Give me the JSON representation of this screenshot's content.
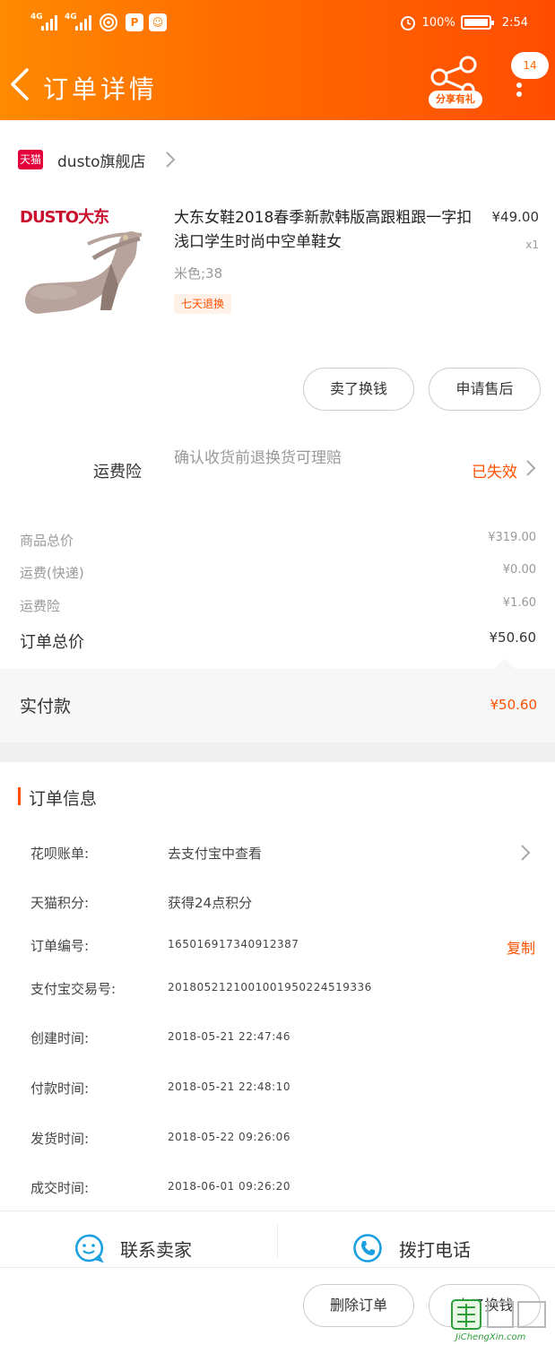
{
  "status_bar": {
    "net1": "4G",
    "net2": "4G",
    "battery": "100%",
    "time": "2:54",
    "icons": [
      "signal-icon",
      "wifi-icon",
      "parking-icon",
      "app-notification-icon",
      "alarm-icon",
      "battery-icon"
    ]
  },
  "header": {
    "title": "订单详情",
    "share_label": "分享有礼",
    "badge_count": "14"
  },
  "store": {
    "platform_badge": "天猫",
    "name": "dusto旗舰店"
  },
  "product": {
    "logo_text": "DUSTO大东",
    "title": "大东女鞋2018春季新款韩版高跟粗跟一字扣浅口学生时尚中空单鞋女",
    "sku": "米色;38",
    "tag": "七天退换",
    "price": "¥49.00",
    "quantity": "x1",
    "actions": [
      "卖了换钱",
      "申请售后"
    ]
  },
  "insurance": {
    "label": "运费险",
    "description": "确认收货前退换货可理赔",
    "status": "已失效"
  },
  "summary": [
    {
      "label": "商品总价",
      "value": "¥319.00"
    },
    {
      "label": "运费(快递)",
      "value": "¥0.00"
    },
    {
      "label": "运费险",
      "value": "¥1.60"
    }
  ],
  "order_total": {
    "label": "订单总价",
    "value": "¥50.60"
  },
  "paid": {
    "label": "实付款",
    "value": "¥50.60"
  },
  "order_info": {
    "title": "订单信息",
    "rows": [
      {
        "key": "花呗账单:",
        "value": "去支付宝中查看"
      },
      {
        "key": "天猫积分:",
        "value": "获得24点积分"
      },
      {
        "key": "订单编号:",
        "value": "165016917340912387"
      },
      {
        "key": "支付宝交易号:",
        "value": "2018052121001001950224519336"
      },
      {
        "key": "创建时间:",
        "value": "2018-05-21 22:47:46"
      },
      {
        "key": "付款时间:",
        "value": "2018-05-21 22:48:10"
      },
      {
        "key": "发货时间:",
        "value": "2018-05-22 09:26:06"
      },
      {
        "key": "成交时间:",
        "value": "2018-06-01 09:26:20"
      }
    ],
    "copy_label": "复制"
  },
  "contact": {
    "seller": "联系卖家",
    "phone": "拨打电话"
  },
  "bottom_actions": [
    "删除订单",
    "卖了换钱"
  ],
  "watermark": {
    "text": "JiChengXin.com"
  },
  "colors": {
    "accent": "#ff5000",
    "header_start": "#ff8a00",
    "header_end": "#ff4d00",
    "tmall_red": "#e4003a",
    "phone_blue": "#1a9fe0"
  }
}
